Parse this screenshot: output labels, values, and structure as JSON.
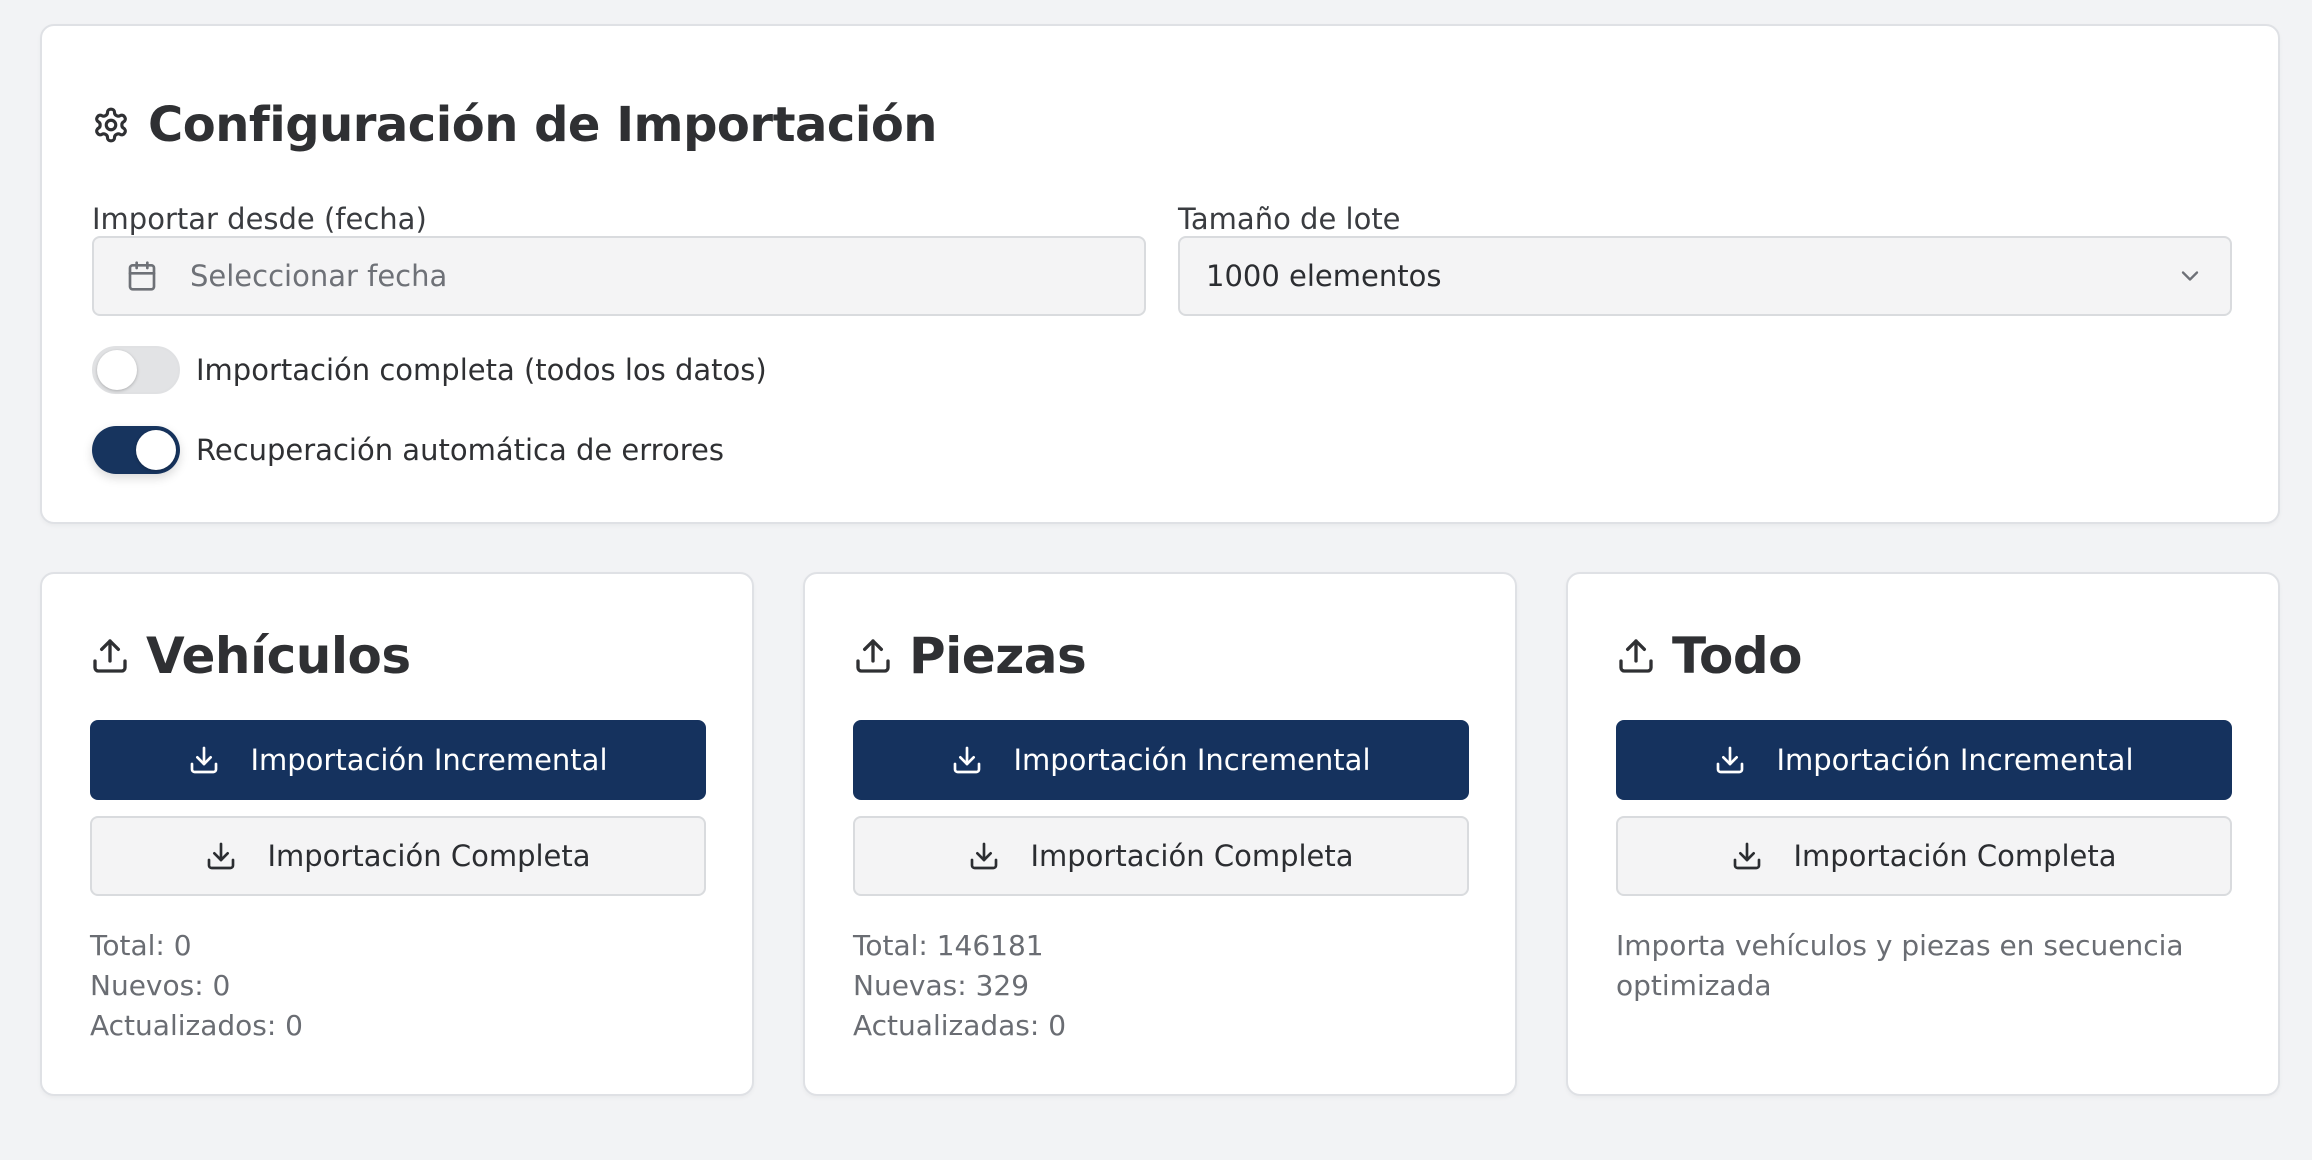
{
  "config": {
    "title": "Configuración de Importación",
    "title_icon": "gear-icon",
    "date_label": "Importar desde (fecha)",
    "date_placeholder": "Seleccionar fecha",
    "batch_label": "Tamaño de lote",
    "batch_value": "1000 elementos",
    "toggles": [
      {
        "label": "Importación completa (todos los datos)",
        "on": false
      },
      {
        "label": "Recuperación automática de errores",
        "on": true
      }
    ]
  },
  "cards": [
    {
      "title": "Vehículos",
      "icon": "upload-icon",
      "incremental_label": "Importación Incremental",
      "full_label": "Importación Completa",
      "stats": [
        "Total: 0",
        "Nuevos: 0",
        "Actualizados: 0"
      ]
    },
    {
      "title": "Piezas",
      "icon": "upload-icon",
      "incremental_label": "Importación Incremental",
      "full_label": "Importación Completa",
      "stats": [
        "Total: 146181",
        "Nuevas: 329",
        "Actualizadas: 0"
      ]
    },
    {
      "title": "Todo",
      "icon": "upload-icon",
      "incremental_label": "Importación Incremental",
      "full_label": "Importación Completa",
      "description": "Importa vehículos y piezas en secuencia optimizada"
    }
  ],
  "colors": {
    "primary": "#15325e",
    "background": "#f2f3f5",
    "muted_text": "#6a6d73"
  }
}
